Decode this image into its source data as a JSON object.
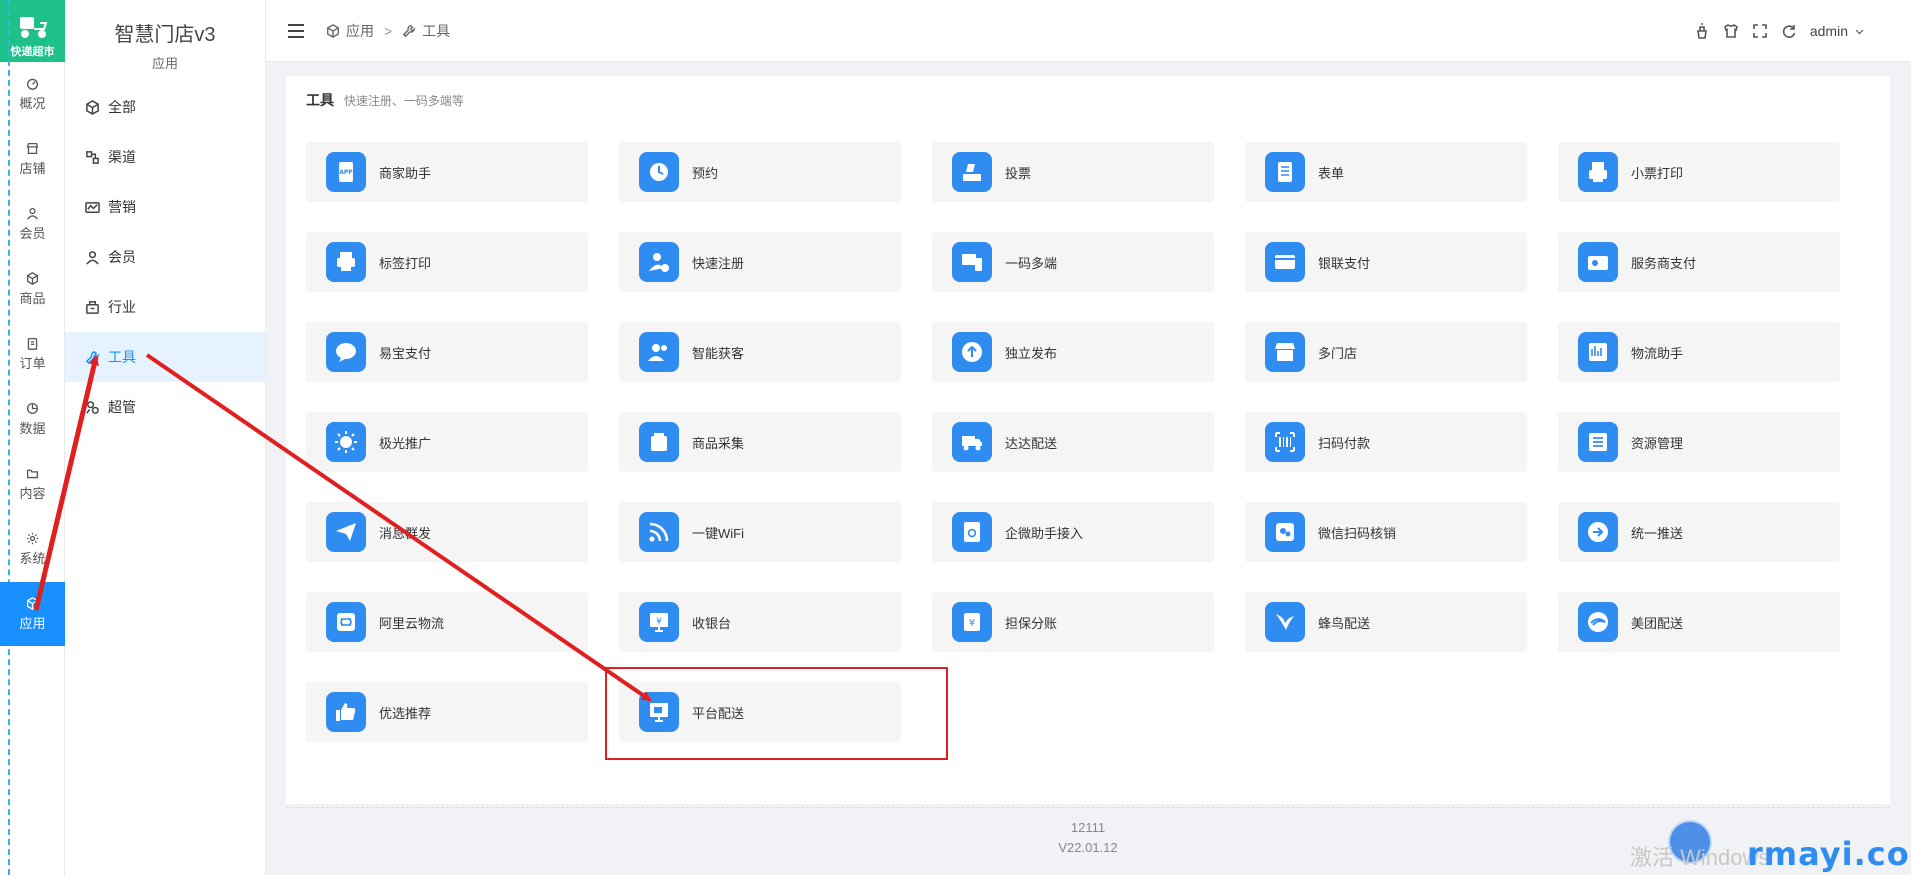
{
  "logo": {
    "text": "快递超市"
  },
  "rail": [
    {
      "label": "概况",
      "icon": "dashboard-icon"
    },
    {
      "label": "店铺",
      "icon": "shop-icon"
    },
    {
      "label": "会员",
      "icon": "user-icon"
    },
    {
      "label": "商品",
      "icon": "box-icon"
    },
    {
      "label": "订单",
      "icon": "order-icon"
    },
    {
      "label": "数据",
      "icon": "chart-pie-icon"
    },
    {
      "label": "内容",
      "icon": "folder-icon"
    },
    {
      "label": "系统",
      "icon": "gear-icon"
    },
    {
      "label": "应用",
      "icon": "cube-icon",
      "active": true
    }
  ],
  "sidebar": {
    "title": "智慧门店v3",
    "subtitle": "应用",
    "items": [
      {
        "label": "全部",
        "icon": "cube-icon"
      },
      {
        "label": "渠道",
        "icon": "channel-icon"
      },
      {
        "label": "营销",
        "icon": "marketing-icon"
      },
      {
        "label": "会员",
        "icon": "user-icon"
      },
      {
        "label": "行业",
        "icon": "industry-icon"
      },
      {
        "label": "工具",
        "icon": "wrench-icon",
        "active": true
      },
      {
        "label": "超管",
        "icon": "admin-icon"
      }
    ]
  },
  "breadcrumb": {
    "first": "应用",
    "separator": ">",
    "second": "工具"
  },
  "header": {
    "user": "admin"
  },
  "section": {
    "title": "工具",
    "description": "快速注册、一码多端等"
  },
  "tools": [
    {
      "label": "商家助手",
      "icon": "app-icon"
    },
    {
      "label": "预约",
      "icon": "clock-icon"
    },
    {
      "label": "投票",
      "icon": "vote-icon"
    },
    {
      "label": "表单",
      "icon": "form-icon"
    },
    {
      "label": "小票打印",
      "icon": "receipt-printer-icon"
    },
    {
      "label": "标签打印",
      "icon": "printer-icon"
    },
    {
      "label": "快速注册",
      "icon": "register-icon"
    },
    {
      "label": "一码多端",
      "icon": "devices-icon"
    },
    {
      "label": "银联支付",
      "icon": "card-icon"
    },
    {
      "label": "服务商支付",
      "icon": "wallet-icon"
    },
    {
      "label": "易宝支付",
      "icon": "chat-bubble-icon"
    },
    {
      "label": "智能获客",
      "icon": "users-icon"
    },
    {
      "label": "独立发布",
      "icon": "upload-icon"
    },
    {
      "label": "多门店",
      "icon": "store-icon"
    },
    {
      "label": "物流助手",
      "icon": "logistics-icon"
    },
    {
      "label": "极光推广",
      "icon": "aurora-icon"
    },
    {
      "label": "商品采集",
      "icon": "collect-icon"
    },
    {
      "label": "达达配送",
      "icon": "truck-icon"
    },
    {
      "label": "扫码付款",
      "icon": "barcode-icon"
    },
    {
      "label": "资源管理",
      "icon": "list-icon"
    },
    {
      "label": "消息群发",
      "icon": "send-icon"
    },
    {
      "label": "一键WiFi",
      "icon": "wifi-icon"
    },
    {
      "label": "企微助手接入",
      "icon": "refresh-doc-icon"
    },
    {
      "label": "微信扫码核销",
      "icon": "wechat-scan-icon"
    },
    {
      "label": "统一推送",
      "icon": "arrow-right-circle-icon"
    },
    {
      "label": "阿里云物流",
      "icon": "cloud-icon"
    },
    {
      "label": "收银台",
      "icon": "cashier-icon"
    },
    {
      "label": "担保分账",
      "icon": "guarantee-icon"
    },
    {
      "label": "蜂鸟配送",
      "icon": "bird-icon"
    },
    {
      "label": "美团配送",
      "icon": "meituan-icon"
    },
    {
      "label": "优选推荐",
      "icon": "thumbs-up-icon"
    },
    {
      "label": "平台配送",
      "icon": "platform-delivery-icon"
    }
  ],
  "footer": {
    "line1": "12111",
    "line2": "V22.01.12"
  },
  "overlay": {
    "watermark": "激活 Windows",
    "brand": "rmayi.com"
  },
  "colors": {
    "accent": "#1890ff",
    "tile_icon": "#2f8cf0",
    "logo": "#1fc08a",
    "annotation": "#e02020"
  }
}
